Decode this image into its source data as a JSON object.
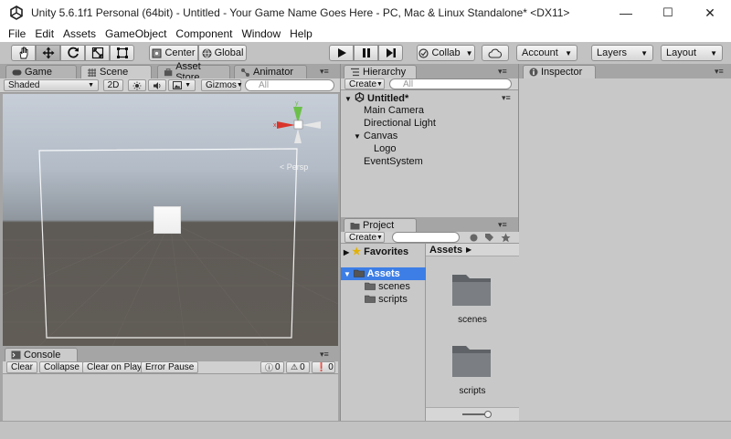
{
  "window": {
    "title": "Unity 5.6.1f1 Personal (64bit) - Untitled - Your Game Name Goes Here - PC, Mac & Linux Standalone* <DX11>",
    "minimize": "—",
    "maximize": "☐",
    "close": "✕"
  },
  "menu": [
    "File",
    "Edit",
    "Assets",
    "GameObject",
    "Component",
    "Window",
    "Help"
  ],
  "toolbar": {
    "center_label": "Center",
    "global_label": "Global",
    "collab_label": "Collab",
    "account_label": "Account",
    "layers_label": "Layers",
    "layout_label": "Layout"
  },
  "scene_panel": {
    "tabs": [
      "Game",
      "Scene",
      "Asset Store",
      "Animator"
    ],
    "shading_mode": "Shaded",
    "mode_2d": "2D",
    "gizmos_label": "Gizmos",
    "search_placeholder": "All",
    "persp_label": "< Persp"
  },
  "hierarchy": {
    "tab": "Hierarchy",
    "create_label": "Create",
    "search_placeholder": "All",
    "scene_name": "Untitled*",
    "items": [
      "Main Camera",
      "Directional Light",
      "Canvas",
      "Logo",
      "EventSystem"
    ]
  },
  "inspector": {
    "tab": "Inspector"
  },
  "project": {
    "tab": "Project",
    "create_label": "Create",
    "favorites_label": "Favorites",
    "assets_label": "Assets",
    "breadcrumb": "Assets",
    "tree_children": [
      "scenes",
      "scripts"
    ],
    "folders": [
      "scenes",
      "scripts"
    ]
  },
  "console": {
    "tab": "Console",
    "clear_label": "Clear",
    "collapse_label": "Collapse",
    "clear_on_play_label": "Clear on Play",
    "error_pause_label": "Error Pause",
    "log_count": "0",
    "warning_count": "0",
    "error_count": "0"
  },
  "colors": {
    "accent_blue": "#3d7ee6",
    "sky_top": "#c5cdd8",
    "ground": "#5e5a55"
  }
}
